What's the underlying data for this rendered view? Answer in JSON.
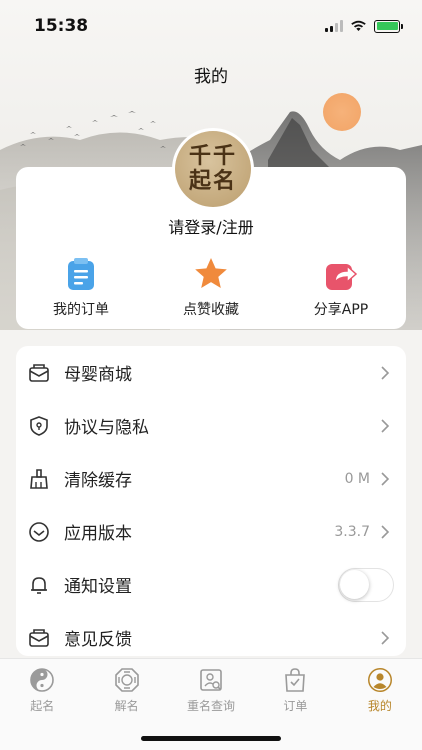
{
  "status_bar": {
    "time": "15:38",
    "icons": [
      "signal-icon",
      "wifi-icon",
      "battery-charging-icon"
    ]
  },
  "nav": {
    "title": "我的"
  },
  "profile": {
    "avatar_text_line1": "千千",
    "avatar_text_line2": "起名",
    "login_prompt": "请登录/注册"
  },
  "quick_actions": [
    {
      "label": "我的订单",
      "icon": "clipboard-icon",
      "color": "#4aa3e8"
    },
    {
      "label": "点赞收藏",
      "icon": "star-icon",
      "color": "#f08a3c"
    },
    {
      "label": "分享APP",
      "icon": "share-icon",
      "color": "#e8546b"
    }
  ],
  "menu": [
    {
      "label": "母婴商城",
      "icon": "mall-icon",
      "value": ""
    },
    {
      "label": "协议与隐私",
      "icon": "shield-icon",
      "value": ""
    },
    {
      "label": "清除缓存",
      "icon": "broom-icon",
      "value": "0 M"
    },
    {
      "label": "应用版本",
      "icon": "version-icon",
      "value": "3.3.7"
    },
    {
      "label": "通知设置",
      "icon": "bell-icon",
      "toggle": false
    },
    {
      "label": "意见反馈",
      "icon": "feedback-icon",
      "value": ""
    }
  ],
  "tabbar": [
    {
      "label": "起名",
      "icon": "yinyang-icon",
      "active": false
    },
    {
      "label": "解名",
      "icon": "bagua-icon",
      "active": false
    },
    {
      "label": "重名查询",
      "icon": "search-person-icon",
      "active": false
    },
    {
      "label": "订单",
      "icon": "shopping-bag-icon",
      "active": false
    },
    {
      "label": "我的",
      "icon": "user-icon",
      "active": true
    }
  ],
  "colors": {
    "accent": "#b8862b",
    "background": "#f4f3f1"
  }
}
